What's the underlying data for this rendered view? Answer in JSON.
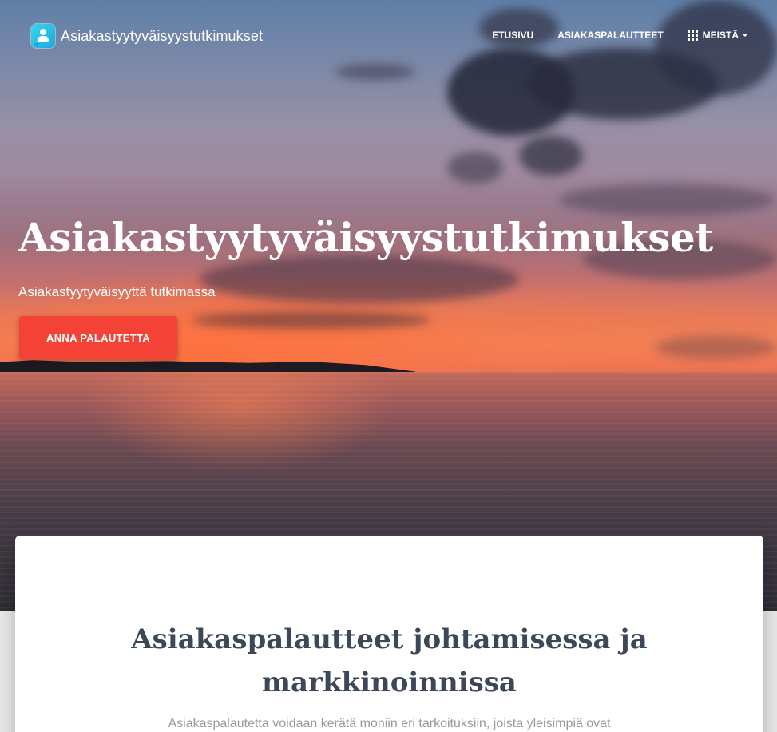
{
  "brand": {
    "name": "Asiakastyytyväisyystutkimukset",
    "logo_icon": "user-chat-icon"
  },
  "nav": {
    "items": [
      {
        "label": "ETUSIVU"
      },
      {
        "label": "ASIAKASPALAUTTEET"
      },
      {
        "label": "MEISTÄ",
        "icon": "apps-grid-icon",
        "has_dropdown": true
      }
    ]
  },
  "hero": {
    "title": "Asiakastyytyväisyystutkimukset",
    "subtitle": "Asiakastyytyväisyyttä tutkimassa",
    "cta_label": "ANNA PALAUTETTA"
  },
  "section": {
    "title": "Asiakaspalautteet johtamisessa ja markkinoinnissa",
    "text": "Asiakaspalautetta voidaan kerätä moniin eri tarkoituksiin, joista yleisimpiä ovat"
  },
  "colors": {
    "accent": "#f44336",
    "heading": "#3c4858",
    "muted_text": "#999999",
    "logo": "#1aa8d8"
  }
}
